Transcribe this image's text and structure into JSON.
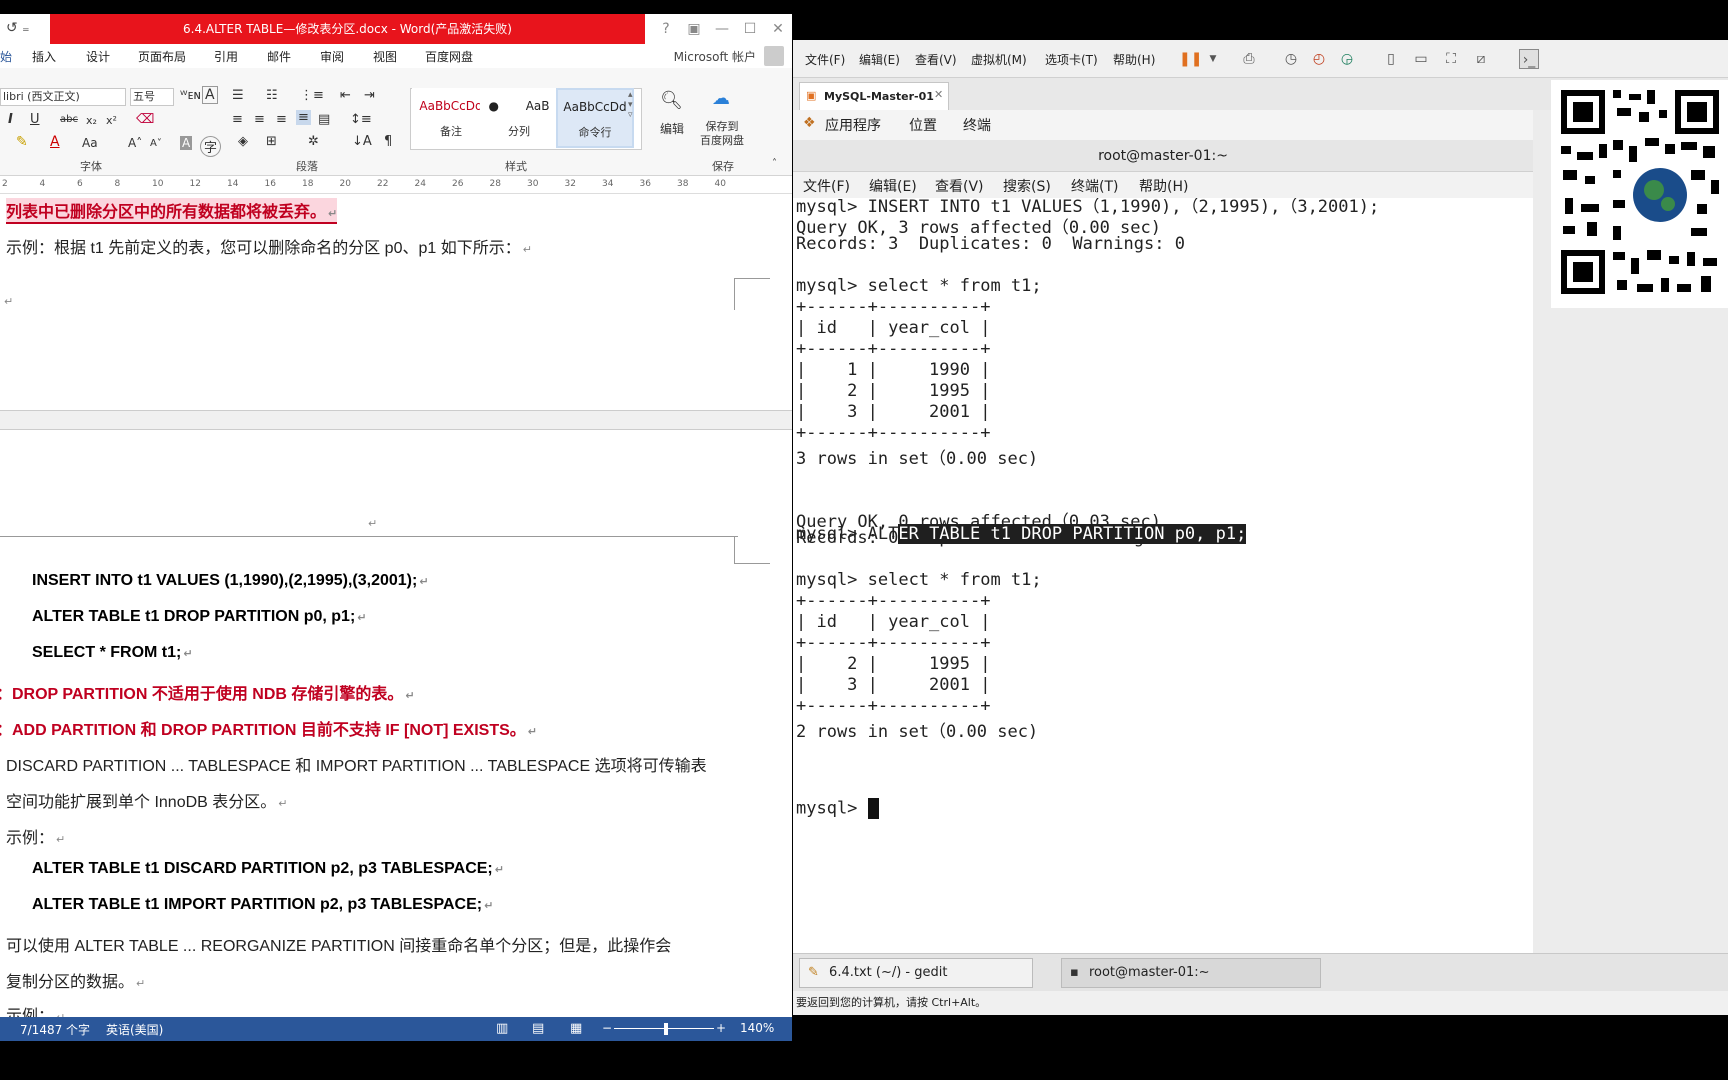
{
  "word": {
    "title": "6.4.ALTER TABLE—修改表分区.docx -  Word(产品激活失败)",
    "account": "Microsoft 帐户",
    "tabs": [
      "插入",
      "设计",
      "页面布局",
      "引用",
      "邮件",
      "审阅",
      "视图",
      "百度网盘"
    ],
    "ribbon": {
      "font_name": "libri (西文正文)",
      "font_size": "五号",
      "group_font": "字体",
      "group_paragraph": "段落",
      "group_styles": "样式",
      "group_save": "保存",
      "styles": [
        {
          "sample": "AaBbCcDd",
          "name": "备注"
        },
        {
          "sample": "AaB",
          "name": "分列"
        },
        {
          "sample": "AaBbCcDd",
          "name": "命令行"
        }
      ],
      "edit_label": "编辑",
      "save_baidu_label": "保存到\n百度网盘"
    },
    "ruler_ticks": [
      "2",
      "4",
      "6",
      "8",
      "10",
      "12",
      "14",
      "16",
      "18",
      "20",
      "22",
      "24",
      "26",
      "28",
      "30",
      "32",
      "34",
      "36",
      "38",
      "40"
    ],
    "doc": {
      "line1": "列表中已删除分区中的所有数据都将被丢弃。",
      "line2": "示例：根据 t1 先前定义的表，您可以删除命名的分区 p0、p1 如下所示：",
      "code1": "INSERT INTO t1 VALUES (1,1990),(2,1995),(3,2001);",
      "code2": "ALTER TABLE t1 DROP PARTITION p0, p1;",
      "code3": "SELECT * FROM t1;",
      "note1": "注：DROP PARTITION 不适用于使用 NDB  存储引擎的表。",
      "note2": "注：ADD PARTITION 和 DROP PARTITION 目前不支持 IF [NOT] EXISTS。",
      "para1a": "DISCARD PARTITION ... TABLESPACE 和 IMPORT PARTITION ... TABLESPACE 选项将可传输表",
      "para1b": "空间功能扩展到单个 InnoDB 表分区。",
      "example": "示例：",
      "code4": "ALTER TABLE t1 DISCARD PARTITION p2, p3 TABLESPACE;",
      "code5": "ALTER TABLE t1 IMPORT PARTITION p2, p3 TABLESPACE;",
      "para2a": "可以使用 ALTER TABLE ... REORGANIZE PARTITION 间接重命名单个分区；但是，此操作会",
      "para2b": "复制分区的数据。",
      "para3": "示例："
    },
    "status": {
      "words": "7/1487 个字",
      "language": "英语(美国)",
      "zoom": "140%"
    }
  },
  "vm": {
    "menus": [
      "文件(F)",
      "编辑(E)",
      "查看(V)",
      "虚拟机(M)",
      "选项卡(T)",
      "帮助(H)"
    ],
    "tab_label": "MySQL-Master-01",
    "gnome": {
      "apps": "应用程序",
      "places": "位置",
      "terminal": "终端"
    },
    "terminal_title": "root@master-01:~",
    "terminal_menus": [
      "文件(F)",
      "编辑(E)",
      "查看(V)",
      "搜索(S)",
      "终端(T)",
      "帮助(H)"
    ],
    "lines": [
      "mysql> INSERT INTO t1 VALUES（1,1990),（2,1995),（3,2001);",
      "Query OK, 3 rows affected（0.00 sec)",
      "Records: 3  Duplicates: 0  Warnings: 0",
      "",
      "mysql> select * from t1;",
      "+------+----------+",
      "| id   | year_col |",
      "+------+----------+",
      "|    1 |     1990 |",
      "|    2 |     1995 |",
      "|    3 |     2001 |",
      "+------+----------+",
      "3 rows in set（0.00 sec)",
      "",
      "",
      "Query OK, 0 rows affected（0.03 sec)",
      "Records: 0  Duplicates: 0  Warnings: 0",
      "",
      "mysql> select * from t1;",
      "+------+----------+",
      "| id   | year_col |",
      "+------+----------+",
      "|    2 |     1995 |",
      "|    3 |     2001 |",
      "+------+----------+",
      "2 rows in set（0.00 sec)",
      ""
    ],
    "alter_prefix": "mysql> ALT",
    "alter_selected": "ER TABLE t1 DROP PARTITION p0, p1;",
    "prompt": "mysql> ",
    "taskbar": [
      "6.4.txt (~/) - gedit",
      "root@master-01:~"
    ],
    "status": "要返回到您的计算机，请按 Ctrl+Alt。"
  }
}
